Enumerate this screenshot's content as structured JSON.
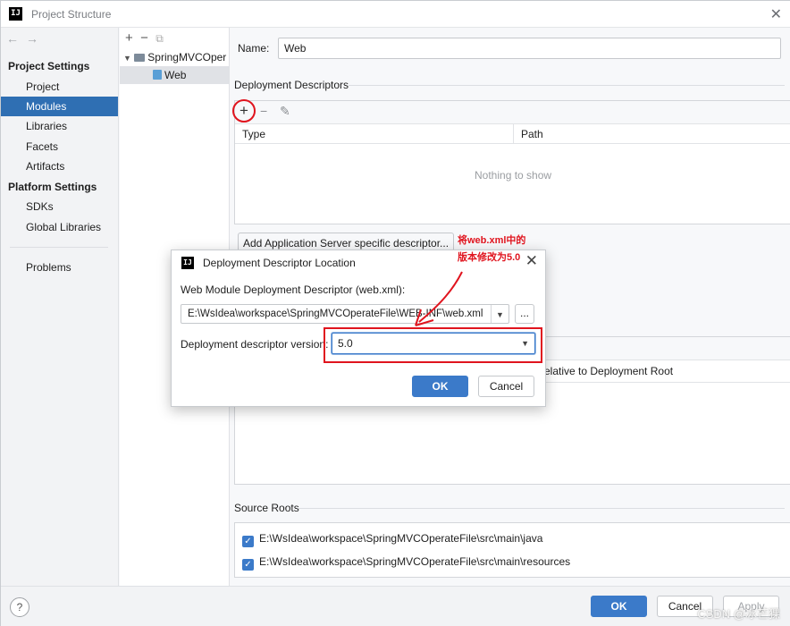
{
  "window": {
    "title": "Project Structure",
    "logo": "IJ"
  },
  "nav": {
    "project_settings_header": "Project Settings",
    "project_settings": [
      "Project",
      "Modules",
      "Libraries",
      "Facets",
      "Artifacts"
    ],
    "platform_settings_header": "Platform Settings",
    "platform_settings": [
      "SDKs",
      "Global Libraries"
    ],
    "problems": "Problems",
    "selected": "Modules"
  },
  "tree": {
    "root": "SpringMVCOper",
    "child": "Web"
  },
  "main": {
    "name_label": "Name:",
    "name_value": "Web",
    "deployment_descriptors_title": "Deployment Descriptors",
    "table_headers": [
      "Type",
      "Path"
    ],
    "empty_text": "Nothing to show",
    "add_server_button": "Add Application Server specific descriptor...",
    "web_root_header_suffix": "elative to Deployment Root",
    "source_roots_title": "Source Roots",
    "source_roots": [
      "E:\\WsIdea\\workspace\\SpringMVCOperateFile\\src\\main\\java",
      "E:\\WsIdea\\workspace\\SpringMVCOperateFile\\src\\main\\resources"
    ]
  },
  "dialog": {
    "title": "Deployment Descriptor Location",
    "path_label": "Web Module Deployment Descriptor (web.xml):",
    "path_value": "E:\\WsIdea\\workspace\\SpringMVCOperateFile\\WEB-INF\\web.xml",
    "browse_label": "...",
    "version_label": "Deployment descriptor version:",
    "version_value": "5.0",
    "ok": "OK",
    "cancel": "Cancel"
  },
  "annotation": {
    "line1": "将web.xml中的",
    "line2": "版本修改为5.0"
  },
  "footer": {
    "help": "?",
    "ok": "OK",
    "cancel": "Cancel",
    "apply": "Apply",
    "watermark": "CSDN @冰芒猓"
  },
  "colors": {
    "accent": "#2f6fb3",
    "primary_button": "#3b7ac9",
    "annotation_red": "#e0141e"
  }
}
